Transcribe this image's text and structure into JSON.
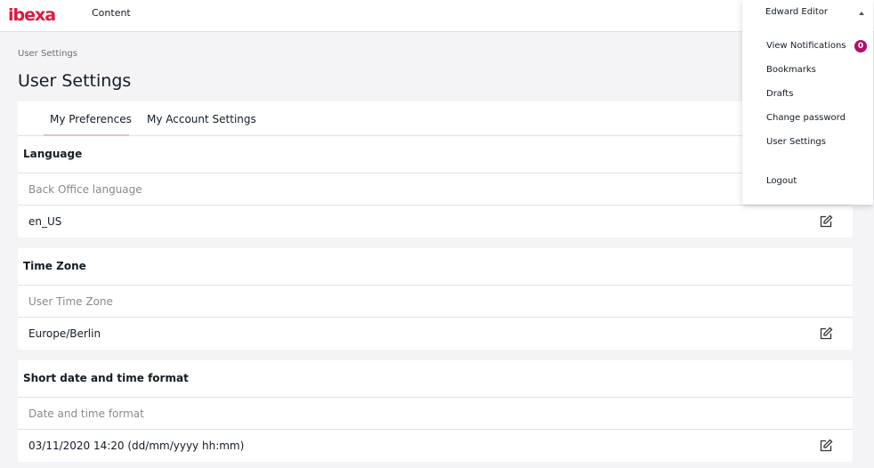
{
  "header": {
    "logo_text": "ibexa",
    "nav_content": "Content",
    "user_name": "Edward Editor"
  },
  "user_menu": {
    "items": [
      {
        "label": "View Notifications"
      },
      {
        "label": "Bookmarks"
      },
      {
        "label": "Drafts"
      },
      {
        "label": "Change password"
      },
      {
        "label": "User Settings"
      },
      {
        "label": "Logout"
      }
    ],
    "notification_count": "0"
  },
  "breadcrumb": "User Settings",
  "page_title": "User Settings",
  "tabs": [
    {
      "label": "My Preferences",
      "active": true
    },
    {
      "label": "My Account Settings",
      "active": false
    }
  ],
  "sections": [
    {
      "title": "Language",
      "field_label": "Back Office language",
      "value": "en_US"
    },
    {
      "title": "Time Zone",
      "field_label": "User Time Zone",
      "value": "Europe/Berlin"
    },
    {
      "title": "Short date and time format",
      "field_label": "Date and time format",
      "value": "03/11/2020 14:20 (dd/mm/yyyy hh:mm)"
    }
  ],
  "colors": {
    "brand": "#e0173d",
    "badge": "#ae1164",
    "background": "#f4f4f7"
  },
  "icons": {
    "edit": "pencil-square-icon",
    "caret": "caret-up-icon"
  }
}
